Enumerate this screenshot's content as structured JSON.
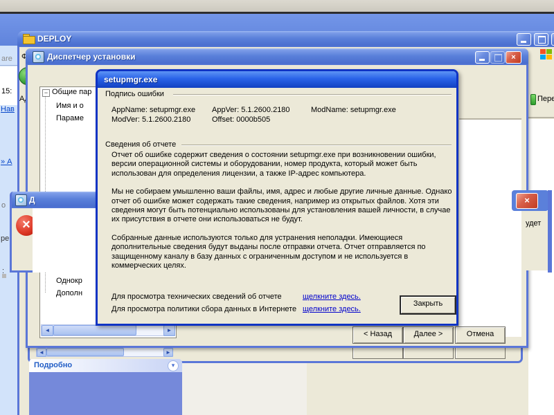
{
  "colors": {
    "accent_blue": "#5a76d8",
    "dialog_border": "#1034c4",
    "beige": "#ece9d8",
    "task_pane_blue": "#7589da",
    "link": "#0000cc"
  },
  "background_fragments": {
    "tab": "are",
    "time": "15:",
    "nav_link": "Нав",
    "arrow_link": "» А",
    "f1": "о",
    "f2": "ре",
    "f3": ":"
  },
  "deploy_window": {
    "title": "DEPLOY",
    "menu_fragment": "Ф.",
    "address_label_fragment": "Ад",
    "go_button_label": "Перехо"
  },
  "setup_wizard": {
    "title": "Диспетчер установки",
    "tree_items": [
      "Общие пар",
      "Имя и о",
      "Параме",
      "Однокр",
      "Дополн"
    ],
    "back_button": "< Назад",
    "next_button": "Далее >",
    "cancel_button": "Отмена"
  },
  "error_report_dialog": {
    "title": "setupmgr.exe",
    "error_signature": {
      "label": "Подпись ошибки",
      "app_name": "AppName: setupmgr.exe",
      "app_ver": "AppVer: 5.1.2600.2180",
      "mod_name": "ModName: setupmgr.exe",
      "mod_ver": "ModVer: 5.1.2600.2180",
      "offset": "Offset: 0000b505"
    },
    "report_details": {
      "label": "Сведения об отчете",
      "paragraph1": "Отчет об ошибке содержит сведения о состоянии setupmgr.exe при возникновении ошибки, версии операционной системы и оборудовании, номер продукта, который может быть использован для определения лицензии, а также IP-адрес компьютера.",
      "paragraph2": "Мы не собираем умышленно ваши файлы, имя, адрес и любые другие личные данные. Однако отчет об ошибке может содержать такие сведения, например из открытых файлов. Хотя эти сведения могут быть потенциально использованы для установления вашей личности, в случае их присутствия в отчете они использоваться не будут.",
      "paragraph3": "Собранные данные используются только для устранения неполадки. Имеющиеся дополнительные сведения будут выданы после отправки отчета. Отчет отправляется по защищенному каналу в базу данных с ограниченным доступом и не используется в коммерческих целях."
    },
    "tech_info_row": {
      "label": "Для просмотра технических сведений об отчете",
      "link": "щелкните здесь."
    },
    "policy_row": {
      "label": "Для просмотра политики сбора данных в Интернете",
      "link": "щелкните здесь."
    },
    "close_button": "Закрыть"
  },
  "error_popup_left": {
    "title_fragment": "Д"
  },
  "error_popup_right": {
    "text_fragment": "удет"
  },
  "explorer_task_pane": {
    "details_header": "Подробно"
  },
  "glyphs": {
    "close_x": "×",
    "error_x": "×",
    "tree_collapse": "−",
    "scroll_left": "◄",
    "scroll_right": "►",
    "chevron_down": "▾",
    "back_arrow": "←"
  }
}
